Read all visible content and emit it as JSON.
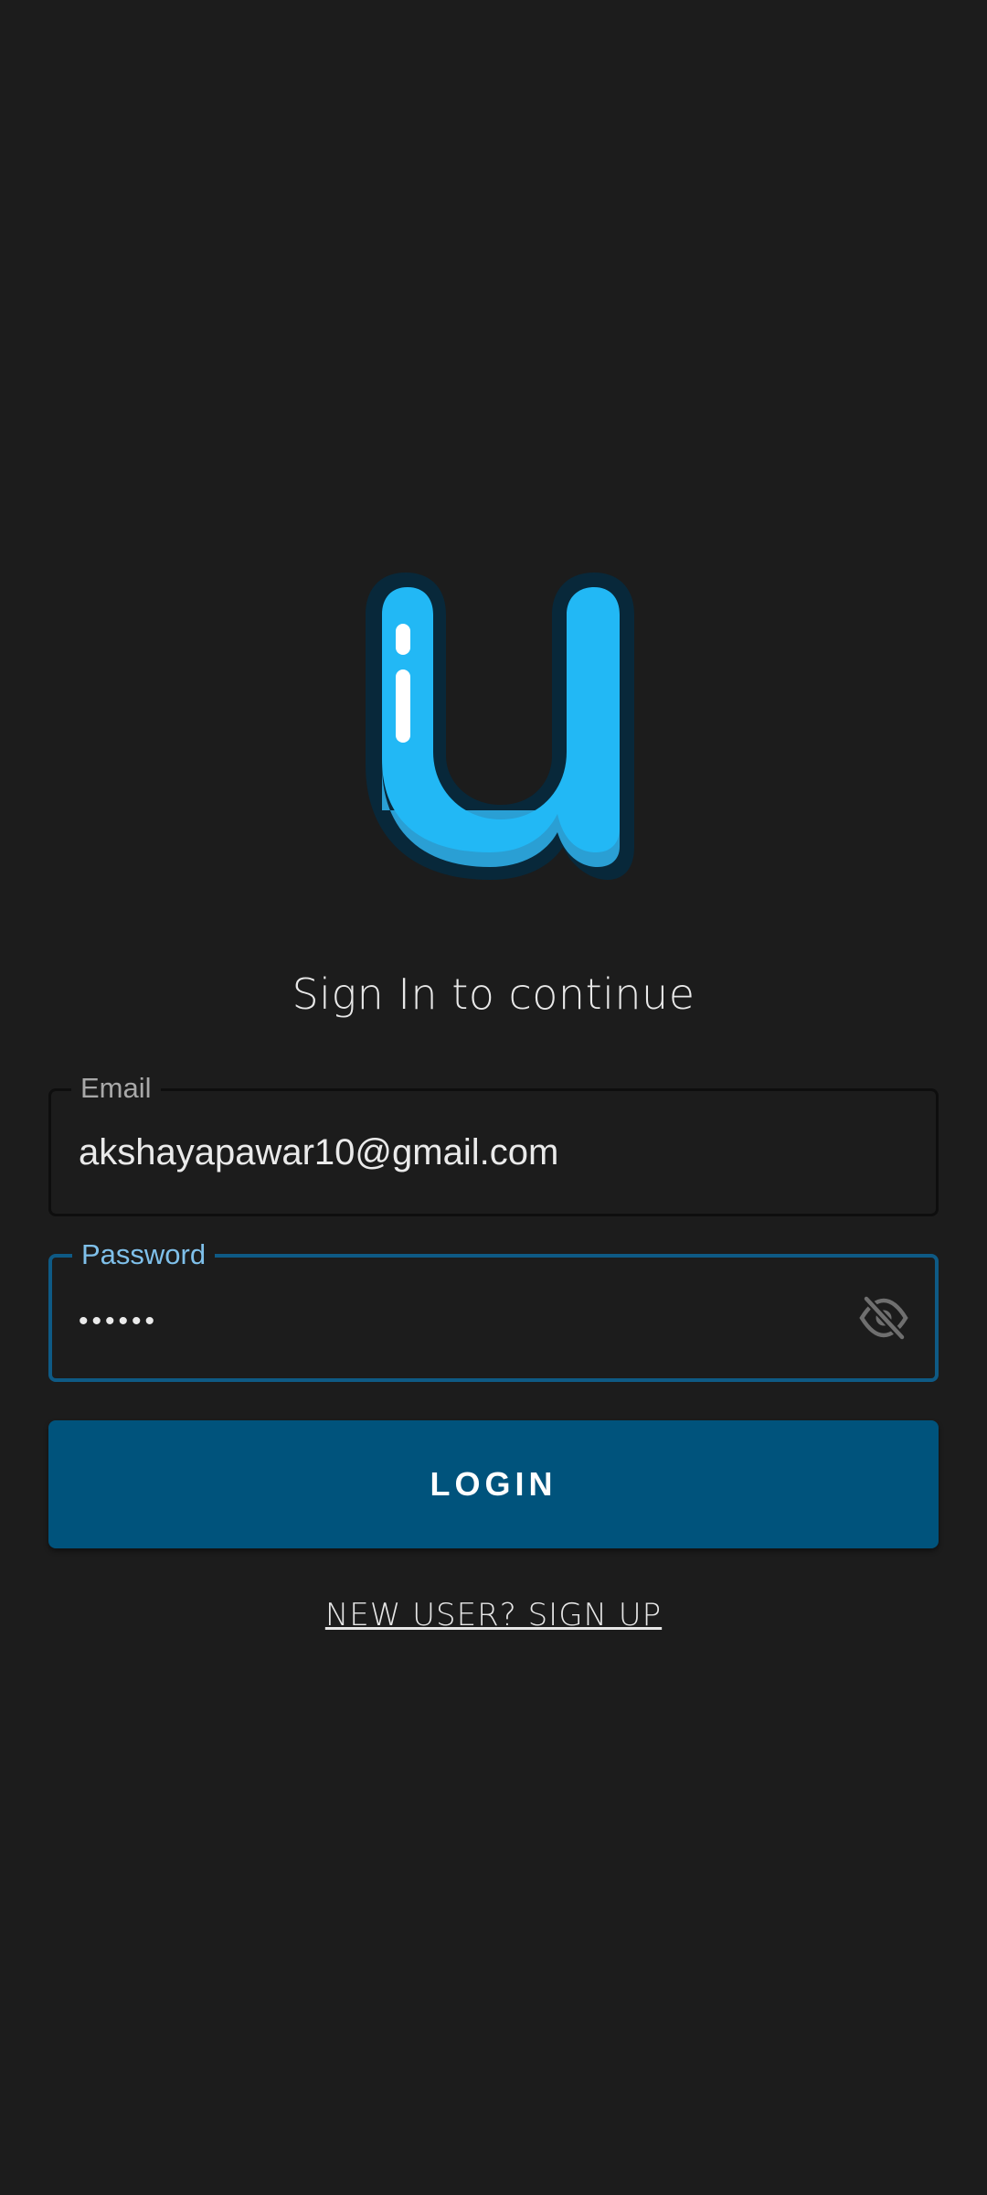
{
  "logo": {
    "icon": "u-logo-icon",
    "colors": {
      "fill": "#22b8f5",
      "shade": "#2a9fd4",
      "outline": "#08283a"
    }
  },
  "subtitle": "Sign In to continue",
  "email": {
    "label": "Email",
    "value": "akshayapawar10@gmail.com"
  },
  "password": {
    "label": "Password",
    "value": "••••••",
    "toggle_icon": "visibility-off-icon"
  },
  "login_button": {
    "label": "LOGIN",
    "color": "#00537c"
  },
  "signup_link": "NEW USER? SIGN UP",
  "colors": {
    "background": "#1c1c1c",
    "focus_border": "#0e5a85",
    "focus_label": "#7fc0ea"
  }
}
